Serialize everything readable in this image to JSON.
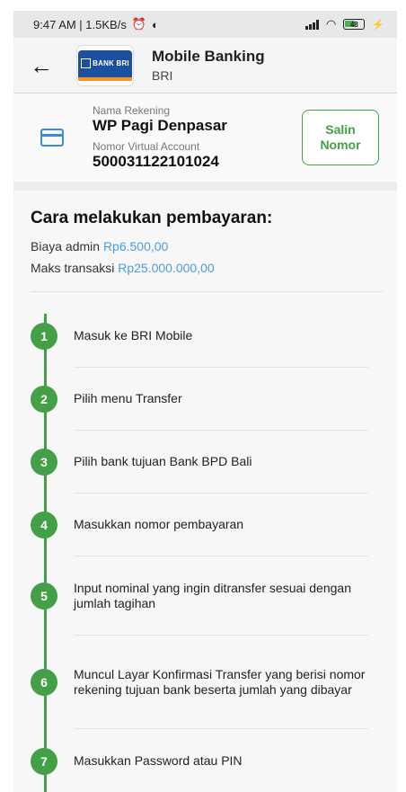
{
  "status_bar": {
    "time_info": "9:47 AM | 1.5KB/s",
    "battery": "48"
  },
  "header": {
    "title": "Mobile Banking",
    "subtitle": "BRI",
    "logo_text": "BANK BRI"
  },
  "account": {
    "name_label": "Nama Rekening",
    "name_value": "WP Pagi Denpasar",
    "va_label": "Nomor Virtual Account",
    "va_value": "500031122101024",
    "copy_button": "Salin Nomor"
  },
  "instructions": {
    "title": "Cara melakukan pembayaran:",
    "admin_label": "Biaya admin",
    "admin_value": "Rp6.500,00",
    "max_label": "Maks transaksi",
    "max_value": "Rp25.000.000,00",
    "steps": [
      {
        "num": "1",
        "text": "Masuk ke BRI Mobile"
      },
      {
        "num": "2",
        "text": "Pilih menu Transfer"
      },
      {
        "num": "3",
        "text": "Pilih bank tujuan Bank BPD Bali"
      },
      {
        "num": "4",
        "text": "Masukkan nomor pembayaran"
      },
      {
        "num": "5",
        "text": "Input nominal yang ingin ditransfer sesuai dengan jumlah tagihan"
      },
      {
        "num": "6",
        "text": "Muncul Layar Konfirmasi Transfer yang berisi nomor rekening tujuan bank beserta jumlah yang dibayar"
      },
      {
        "num": "7",
        "text": "Masukkan Password atau PIN"
      }
    ]
  },
  "colors": {
    "accent_green": "#43a047",
    "link_blue": "#4a9de0",
    "bri_blue": "#1c4f9e",
    "bri_orange": "#f7941d"
  }
}
